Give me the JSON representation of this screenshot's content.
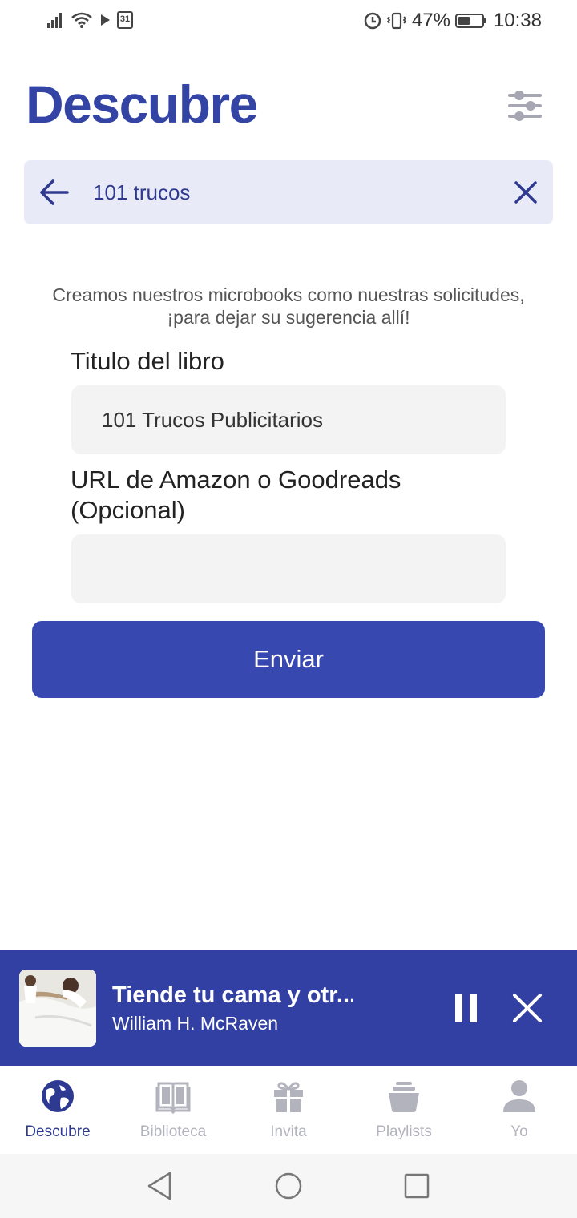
{
  "status_bar": {
    "calendar_day": "31",
    "battery_percent_label": "47%",
    "time": "10:38",
    "icons": [
      "signal-icon",
      "wifi-icon",
      "play-icon",
      "calendar-icon",
      "data-saver-icon",
      "vibrate-icon",
      "battery-icon"
    ]
  },
  "header": {
    "title": "Descubre",
    "filter_icon": "sliders-icon"
  },
  "search": {
    "value": "101 trucos",
    "back_icon": "arrow-left-icon",
    "clear_icon": "close-icon"
  },
  "form": {
    "intro": "Creamos nuestros microbooks como nuestras solicitudes, ¡para dejar su sugerencia allí!",
    "title_label": "Titulo del libro",
    "title_value": "101 Trucos Publicitarios",
    "url_label": "URL de Amazon o Goodreads (Opcional)",
    "url_value": "",
    "submit_label": "Enviar"
  },
  "player": {
    "title": "Tiende tu cama y otr...",
    "author": "William H. McRaven"
  },
  "nav": {
    "items": [
      {
        "label": "Descubre",
        "icon": "globe-icon",
        "active": true
      },
      {
        "label": "Biblioteca",
        "icon": "book-icon",
        "active": false
      },
      {
        "label": "Invita",
        "icon": "gift-icon",
        "active": false
      },
      {
        "label": "Playlists",
        "icon": "playlist-stack-icon",
        "active": false
      },
      {
        "label": "Yo",
        "icon": "user-icon",
        "active": false
      }
    ]
  },
  "colors": {
    "brand": "#3344a4",
    "button": "#3848b1",
    "player_bg": "#3340a3",
    "search_bg": "#e8eaf8",
    "nav_inactive": "#b3b3bd"
  }
}
